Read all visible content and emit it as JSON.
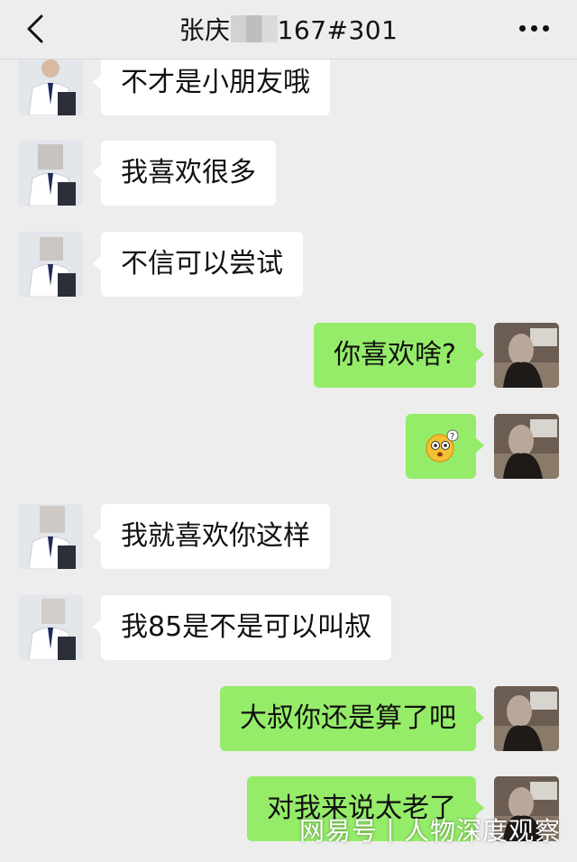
{
  "header": {
    "title_prefix": "张庆",
    "title_suffix": "167#301",
    "back_icon": "chevron-left-icon",
    "more_icon": "more-dots-icon"
  },
  "messages": [
    {
      "side": "left",
      "text": "不才是小朋友哦"
    },
    {
      "side": "left",
      "text": "我喜欢很多"
    },
    {
      "side": "left",
      "text": "不信可以尝试"
    },
    {
      "side": "right",
      "text": "你喜欢啥?"
    },
    {
      "side": "right",
      "text": "",
      "emoji": "confused-face-icon"
    },
    {
      "side": "left",
      "text": "我就喜欢你这样"
    },
    {
      "side": "left",
      "text": "我85是不是可以叫叔"
    },
    {
      "side": "right",
      "text": "大叔你还是算了吧"
    },
    {
      "side": "right",
      "text": "对我来说太老了"
    }
  ],
  "watermark": "网易号丨人物深度观察",
  "colors": {
    "background": "#ededed",
    "incoming_bubble": "#ffffff",
    "outgoing_bubble": "#95ec69"
  }
}
